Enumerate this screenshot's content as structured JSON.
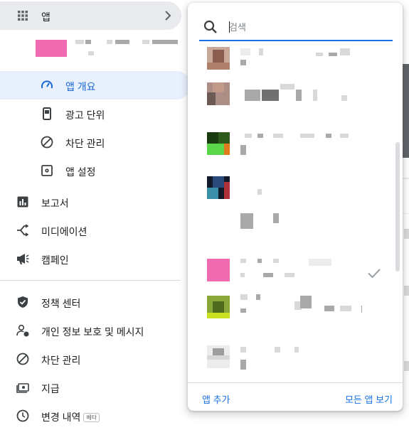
{
  "sidebar": {
    "apps_label": "앱",
    "sub_items": [
      {
        "label": "앱 개요",
        "icon": "dashboard-gauge-icon"
      },
      {
        "label": "광고 단위",
        "icon": "ad-unit-phone-icon"
      },
      {
        "label": "차단 관리",
        "icon": "block-icon"
      },
      {
        "label": "앱 설정",
        "icon": "settings-box-icon"
      }
    ],
    "main_items": [
      {
        "label": "보고서",
        "icon": "bar-chart-icon"
      },
      {
        "label": "미디에이션",
        "icon": "mediation-icon"
      },
      {
        "label": "캠페인",
        "icon": "campaign-megaphone-icon"
      }
    ],
    "lower_items": [
      {
        "label": "정책 센터",
        "icon": "shield-check-icon"
      },
      {
        "label": "개인 정보 보호 및 메시지",
        "icon": "person-privacy-icon"
      },
      {
        "label": "차단 관리",
        "icon": "block-icon"
      },
      {
        "label": "지급",
        "icon": "payments-icon"
      },
      {
        "label": "변경 내역",
        "badge": "베타",
        "icon": "history-icon"
      }
    ]
  },
  "popup": {
    "search": {
      "placeholder": "검색",
      "value": ""
    },
    "selected_index": 4,
    "footer": {
      "add_app": "앱 추가",
      "view_all": "모든 앱 보기"
    }
  },
  "colors": {
    "accent": "#1a73e8",
    "active_bg": "#e8f0fe",
    "apps_row_bg": "#e8eaed",
    "selected_thumb": "#f06bb0"
  }
}
